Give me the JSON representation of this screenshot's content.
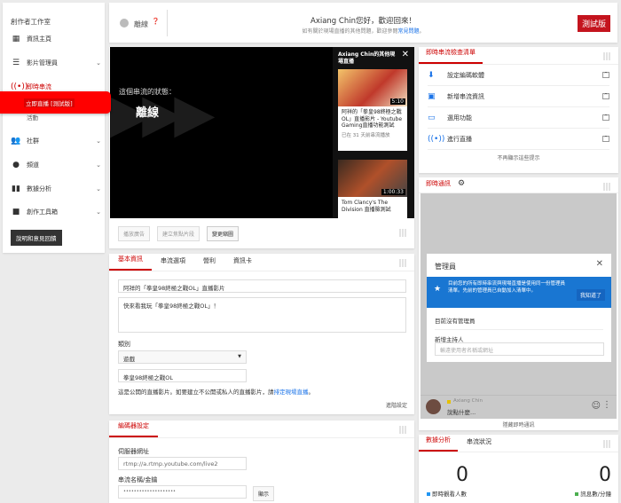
{
  "sidebar": {
    "title": "創作者工作室",
    "items": [
      {
        "label": "資訊主頁",
        "icon": "dashboard-icon"
      },
      {
        "label": "影片管理員",
        "icon": "video-manager-icon"
      },
      {
        "label": "即時串流",
        "icon": "live-icon"
      },
      {
        "label": "社群",
        "icon": "community-icon"
      },
      {
        "label": "頻道",
        "icon": "channel-icon"
      },
      {
        "label": "數據分析",
        "icon": "analytics-icon"
      },
      {
        "label": "創作工具箱",
        "icon": "toolbox-icon"
      }
    ],
    "sub_items": [
      "立即直播 [測試版]",
      "活動"
    ],
    "help_button": "說明和意見回饋"
  },
  "topbar": {
    "status": "離線",
    "greeting": "Axiang Chin您好，歡迎回來！",
    "sub_text": "如有關於現場直播的其他問題，歡迎參閱",
    "faq_link": "常見問題",
    "sub_end": "。",
    "beta_badge": "測試版"
  },
  "player": {
    "status_label": "這個串流的狀態：",
    "status_value": "離線",
    "overlay_title": "Axiang Chin的其他現場直播",
    "videos": [
      {
        "title": "阿祥的「拳皇98終極之戰OL」直播影片 - Youtube Gaming直播功能測試",
        "meta": "已在 31 天前串流播放",
        "duration": "5:10"
      },
      {
        "title": "Tom Clancy's The Division 直播險測試",
        "duration": "1:00:33"
      }
    ],
    "buttons": [
      "播放廣告",
      "建立焦點片段",
      "變更縮圖"
    ]
  },
  "basic_info": {
    "tabs": [
      "基本資訊",
      "串流選項",
      "營利",
      "資訊卡"
    ],
    "title_value": "阿祥的「拳皇98終極之戰OL」直播影片",
    "description_value": "快來看我玩「拳皇98終極之戰OL」！",
    "category_label": "類別",
    "category_value": "遊戲",
    "game_value": "拳皇98終極之戰OL",
    "notice": "這是公開的直播影片。如要建立不公開或私人的直播影片，請",
    "notice_link": "排定現場直播",
    "notice_end": "。",
    "advanced": "進階設定"
  },
  "encoder": {
    "tab": "編碼器設定",
    "server_label": "伺服器網址",
    "server_value": "rtmp://a.rtmp.youtube.com/live2",
    "key_label": "串流名稱/金鑰",
    "key_value": "••••••••••••••••••••",
    "show_button": "顯示"
  },
  "checklist": {
    "title": "即時串流檢查清單",
    "items": [
      {
        "label": "設定編碼軟體",
        "icon": "download-icon"
      },
      {
        "label": "新增串流資訊",
        "icon": "bar-chart-icon"
      },
      {
        "label": "選用功能",
        "icon": "card-icon"
      },
      {
        "label": "進行直播",
        "icon": "broadcast-icon"
      }
    ],
    "dismiss": "不再顯示這些提示"
  },
  "chat": {
    "title": "即時通訊",
    "modal_title": "管理員",
    "notice": "目前您的所有即時串流與現場直播是使用同一份管理員清單。先前的管理員已自動加入清單中。",
    "got_it": "我知道了",
    "no_mods": "目前沒有管理員",
    "add_label": "新增主持人",
    "add_placeholder": "輸遠使用者名稱或網址",
    "user": "Axiang Chin",
    "input_placeholder": "說點什麼...",
    "hide": "隱藏即時通訊"
  },
  "analytics": {
    "tabs": [
      "數據分析",
      "串流狀況"
    ],
    "viewers": "0",
    "viewers_label": "即時觀看人數",
    "messages": "0",
    "messages_label": "訊息數/分鐘",
    "viewers_color": "#2196f3",
    "messages_color": "#4caf50"
  },
  "colors": {
    "accent": "#cc0000",
    "link": "#1a73e8",
    "banner": "#1976d2"
  }
}
